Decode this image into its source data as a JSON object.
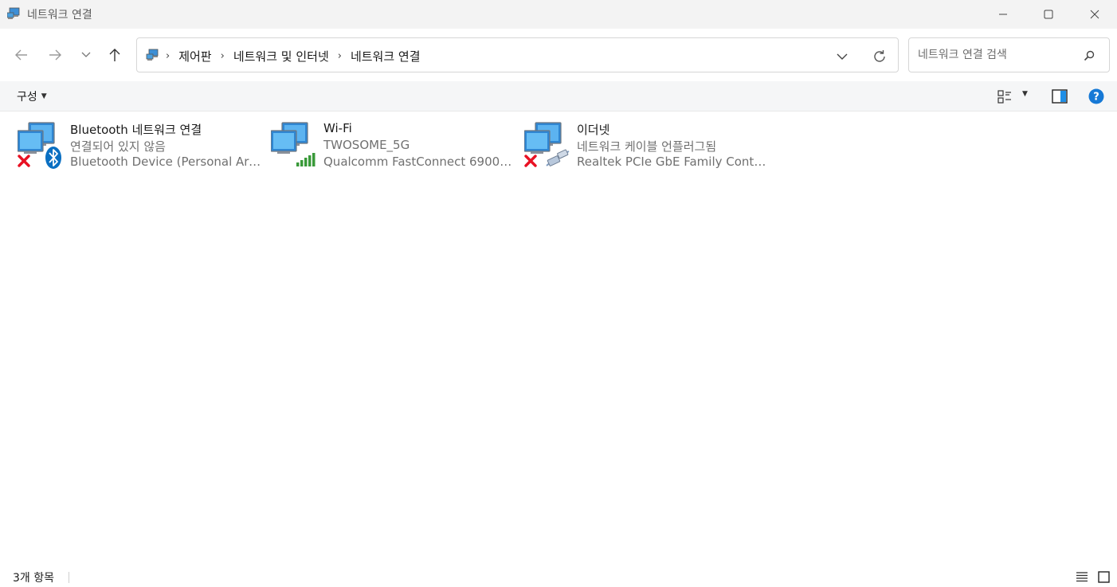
{
  "window": {
    "title": "네트워크 연결",
    "controls": [
      "minimize",
      "maximize",
      "close"
    ]
  },
  "navigation": {
    "breadcrumbs": [
      "제어판",
      "네트워크 및 인터넷",
      "네트워크 연결"
    ],
    "search_placeholder": "네트워크 연결 검색"
  },
  "commandbar": {
    "organize_label": "구성"
  },
  "connections": [
    {
      "name": "Bluetooth 네트워크 연결",
      "status": "연결되어 있지 않음",
      "device": "Bluetooth Device (Personal Area ...",
      "state": "disconnected",
      "adapter_icon": "bluetooth-icon"
    },
    {
      "name": "Wi-Fi",
      "status": "TWOSOME_5G",
      "device": "Qualcomm FastConnect 6900 Wi...",
      "state": "connected",
      "adapter_icon": "wifi-signal-icon"
    },
    {
      "name": "이더넷",
      "status": "네트워크 케이블 언플러그됨",
      "device": "Realtek PCIe GbE Family Control...",
      "state": "disconnected",
      "adapter_icon": "ethernet-cable-icon"
    }
  ],
  "statusbar": {
    "item_count": "3개 항목"
  },
  "colors": {
    "disconnected": "#e81123",
    "bluetooth": "#0078d4",
    "signal": "#3a9a3a",
    "help": "#1679d6"
  }
}
